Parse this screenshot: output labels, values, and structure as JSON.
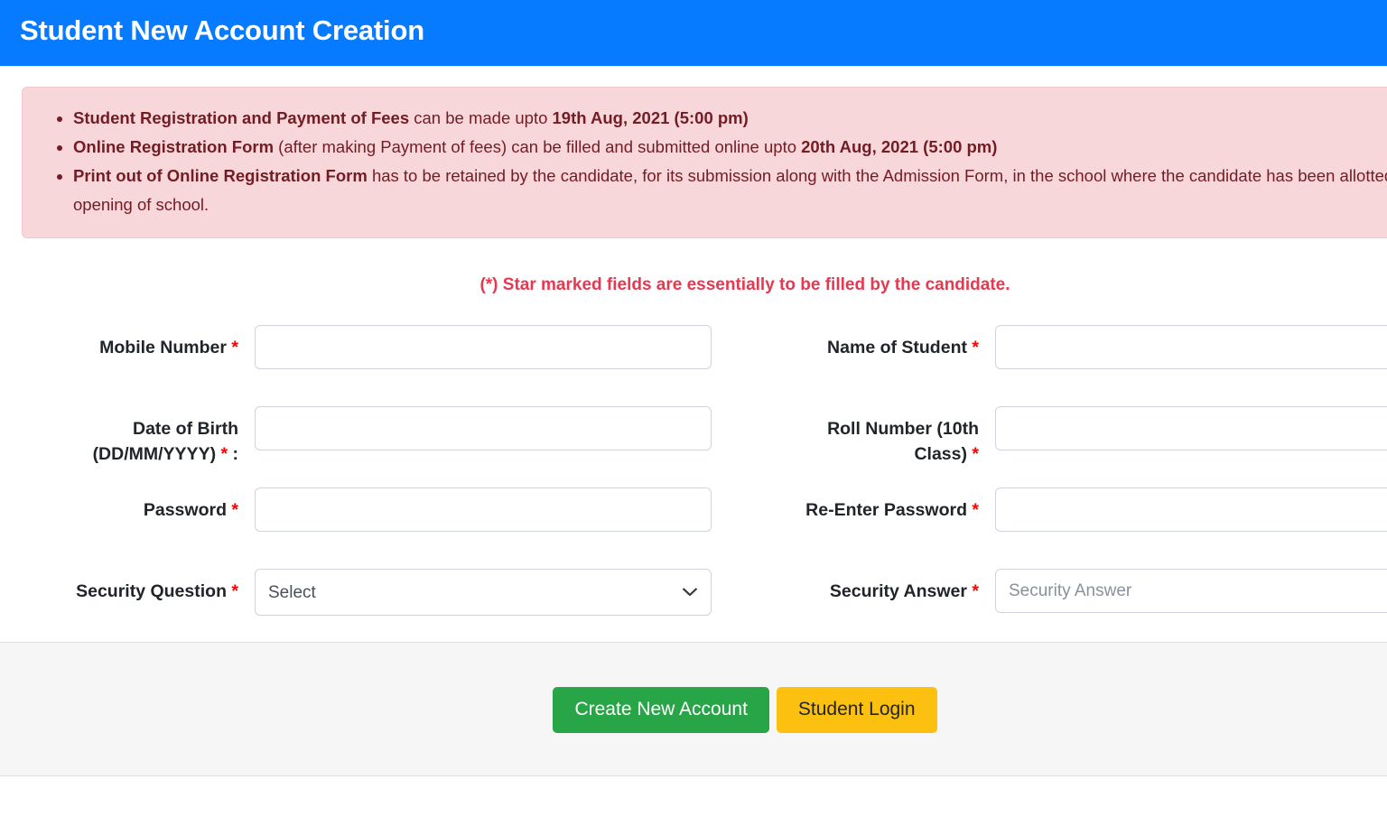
{
  "header": {
    "title": "Student New Account Creation",
    "background_color": "#077bff"
  },
  "alert": {
    "background_color": "#f8d7da",
    "text_color": "#721c24",
    "bullets": [
      {
        "bold_lead": "Student Registration and Payment of Fees",
        "middle": " can be made upto ",
        "bold_tail": "19th Aug, 2021 (5:00 pm)",
        "rest": ""
      },
      {
        "bold_lead": "Online Registration Form",
        "middle": " (after making Payment of fees) can be filled and submitted online upto ",
        "bold_tail": "20th Aug, 2021 (5:00 pm)",
        "rest": ""
      },
      {
        "bold_lead": "Print out of Online Registration Form",
        "middle": " has to be retained by the candidate, for its submission along with the Admission Form, in the school where the candidate has been allotted seat, after opening of school.",
        "bold_tail": "",
        "rest": ""
      }
    ]
  },
  "note": {
    "text": "(*) Star marked fields are essentially to be filled by the candidate.",
    "color": "#e8384f"
  },
  "form": {
    "required_marker": "*",
    "rows": [
      {
        "left": {
          "label": "Mobile Number",
          "required": true,
          "type": "text",
          "value": "",
          "placeholder": ""
        },
        "right": {
          "label": "Name of Student",
          "required": true,
          "type": "text",
          "value": "",
          "placeholder": ""
        }
      },
      {
        "left": {
          "label": "Date of Birth (DD/MM/YYYY)",
          "suffix": " :",
          "required": true,
          "type": "text",
          "value": "",
          "placeholder": ""
        },
        "right": {
          "label": "Roll Number (10th Class)",
          "required": true,
          "type": "text",
          "value": "",
          "placeholder": ""
        }
      },
      {
        "left": {
          "label": "Password",
          "required": true,
          "type": "password",
          "value": "",
          "placeholder": ""
        },
        "right": {
          "label": "Re-Enter Password",
          "required": true,
          "type": "password",
          "value": "",
          "placeholder": ""
        }
      },
      {
        "left": {
          "label": "Security Question",
          "required": true,
          "type": "select",
          "selected": "Select",
          "options": [
            "Select"
          ]
        },
        "right": {
          "label": "Security Answer",
          "required": true,
          "type": "text",
          "value": "",
          "placeholder": "Security Answer"
        }
      }
    ]
  },
  "labels": {
    "mobile_number": "Mobile Number",
    "name_of_student": "Name of Student",
    "date_of_birth_line1": "Date of Birth",
    "date_of_birth_line2": "(DD/MM/YYYY)",
    "date_of_birth_suffix": ":",
    "roll_number_line1": "Roll Number (10th",
    "roll_number_line2": "Class)",
    "password": "Password",
    "re_enter_password": "Re-Enter Password",
    "security_question": "Security Question",
    "security_answer": "Security Answer"
  },
  "select": {
    "security_question_selected": "Select",
    "chevron_icon": "chevron-down-icon"
  },
  "placeholders": {
    "security_answer": "Security Answer"
  },
  "footer": {
    "background_color": "#f6f6f6",
    "buttons": [
      {
        "label": "Create New Account",
        "color": "#28a546",
        "text_color": "#ffffff"
      },
      {
        "label": "Student Login",
        "color": "#fcc011",
        "text_color": "#212529"
      }
    ]
  },
  "buttons": {
    "create_new_account": "Create New Account",
    "student_login": "Student Login"
  }
}
